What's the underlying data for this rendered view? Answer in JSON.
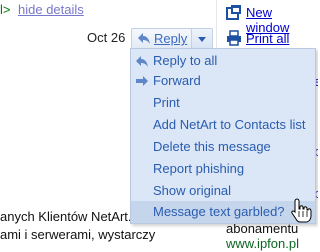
{
  "header": {
    "gt_fragment": "l>",
    "hide_details": "hide details",
    "date": "Oct 26",
    "reply": "Reply"
  },
  "right": {
    "new_window": "New window",
    "print_all": "Print all",
    "frag_e": "e",
    "frag_l": "l",
    "frag_p1": "p",
    "frag_p2": "p"
  },
  "menu": {
    "items": [
      {
        "label": "Reply to all",
        "icon": "reply-all-icon"
      },
      {
        "label": "Forward",
        "icon": "forward-icon"
      },
      {
        "label": "Print"
      },
      {
        "label": "Add NetArt to Contacts list"
      },
      {
        "label": "Delete this message"
      },
      {
        "label": "Report phishing"
      },
      {
        "label": "Show original"
      },
      {
        "label": "Message text garbled?"
      }
    ]
  },
  "body": {
    "line1": "anych Klientów NetArt.",
    "line2": "ami i serwerami, wystarczy"
  },
  "ad": {
    "text": "abonamentu",
    "url": "www.ipfon.pl"
  },
  "colors": {
    "link": "#0000cc",
    "menu_bg": "#dbe6f6",
    "menu_text": "#2a5db0",
    "highlight": "#c5d5ec"
  }
}
